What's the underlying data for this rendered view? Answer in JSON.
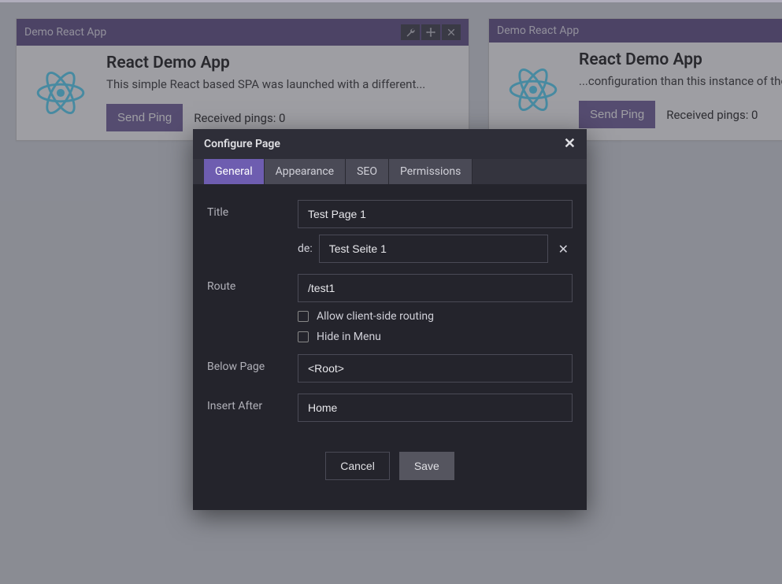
{
  "cards": [
    {
      "header": "Demo React App",
      "title": "React Demo App",
      "desc": "This simple React based SPA was launched with a different...",
      "ping_btn": "Send Ping",
      "ping_text": "Received pings: 0",
      "show_toolbar": true
    },
    {
      "header": "Demo React App",
      "title": "React Demo App",
      "desc": "...configuration than this instance of the",
      "ping_btn": "Send Ping",
      "ping_text": "Received pings: 0",
      "show_toolbar": false
    }
  ],
  "modal": {
    "title": "Configure Page",
    "tabs": [
      "General",
      "Appearance",
      "SEO",
      "Permissions"
    ],
    "active_tab_index": 0,
    "form": {
      "title_label": "Title",
      "title_value": "Test Page 1",
      "title_de_prefix": "de:",
      "title_de_value": "Test Seite 1",
      "route_label": "Route",
      "route_value": "/test1",
      "allow_routing_label": "Allow client-side routing",
      "allow_routing_checked": false,
      "hide_menu_label": "Hide in Menu",
      "hide_menu_checked": false,
      "below_label": "Below Page",
      "below_value": "<Root>",
      "after_label": "Insert After",
      "after_value": "Home"
    },
    "cancel_label": "Cancel",
    "save_label": "Save"
  },
  "colors": {
    "accent": "#6e5db0",
    "header": "#6a5a8e"
  }
}
